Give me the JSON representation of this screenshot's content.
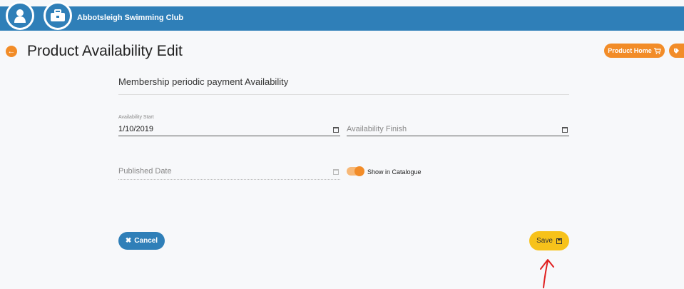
{
  "header": {
    "club_name": "Abbotsleigh Swimming Club",
    "user_icon": "user-icon",
    "briefcase_icon": "briefcase-icon"
  },
  "page": {
    "title": "Product Availability Edit",
    "back_icon": "arrow-left-icon",
    "product_home_label": "Product Home",
    "product_home_icon": "cart-icon",
    "tag_icon": "tag-icon"
  },
  "form": {
    "section_title": "Membership periodic payment Availability",
    "availability_start_label": "Availability Start",
    "availability_start_value": "1/10/2019",
    "availability_finish_placeholder": "Availability Finish",
    "published_date_placeholder": "Published Date",
    "show_in_catalogue_label": "Show in Catalogue",
    "show_in_catalogue_on": true
  },
  "actions": {
    "cancel_label": "Cancel",
    "save_label": "Save"
  },
  "colors": {
    "header_blue": "#2f7fb8",
    "accent_orange": "#f28c28",
    "save_yellow": "#f7c21a",
    "annotation_red": "#e02020"
  }
}
